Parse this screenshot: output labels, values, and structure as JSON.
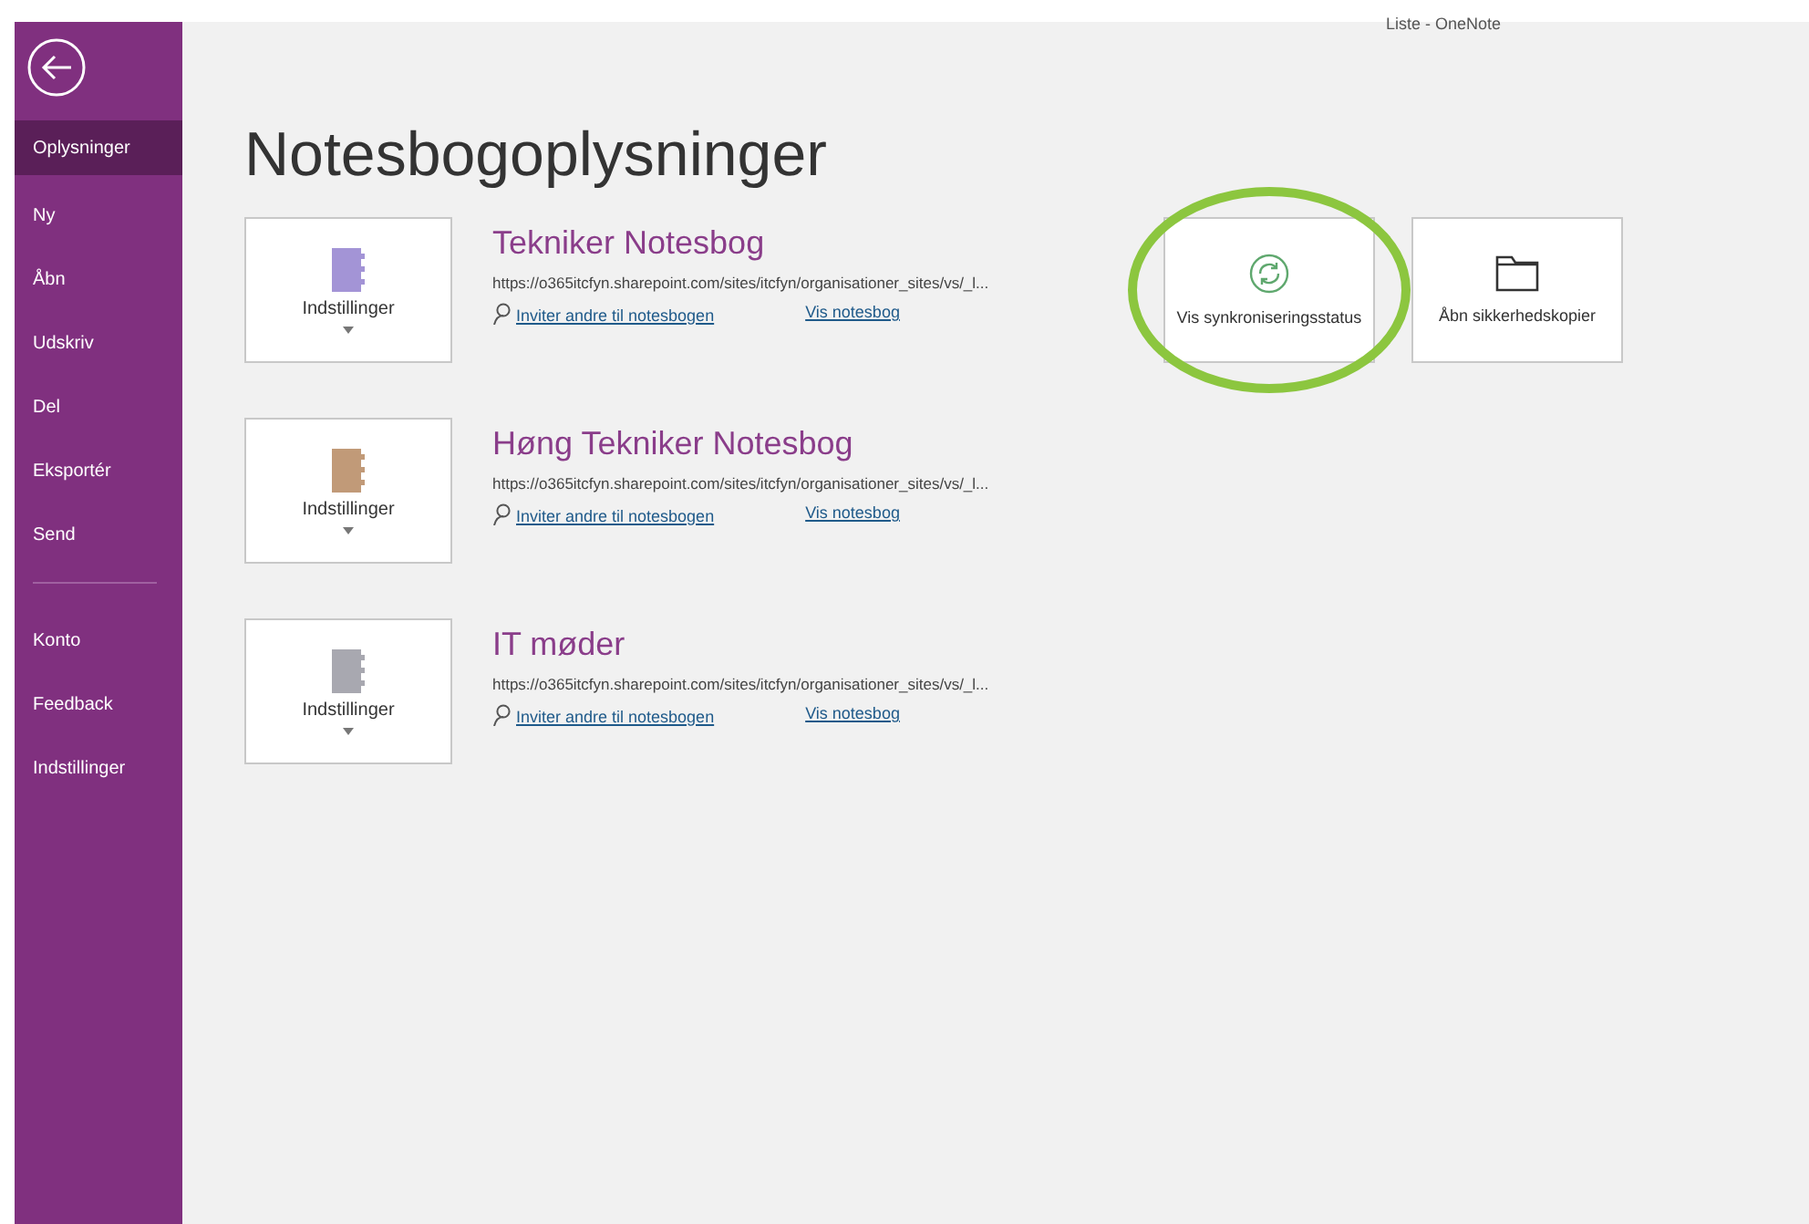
{
  "window": {
    "title": "Liste - OneNote"
  },
  "sidebar": {
    "nav_items": [
      {
        "label": "Oplysninger",
        "selected": true
      },
      {
        "label": "Ny",
        "selected": false
      },
      {
        "label": "Åbn",
        "selected": false
      },
      {
        "label": "Udskriv",
        "selected": false
      },
      {
        "label": "Del",
        "selected": false
      },
      {
        "label": "Eksportér",
        "selected": false
      },
      {
        "label": "Send",
        "selected": false
      }
    ],
    "account_items": [
      {
        "label": "Konto",
        "selected": false
      },
      {
        "label": "Feedback",
        "selected": false
      },
      {
        "label": "Indstillinger",
        "selected": false
      }
    ]
  },
  "page_title": "Notesbogoplysninger",
  "notebooks": [
    {
      "name": "Tekniker Notesbog",
      "color": "#a394d6",
      "settings": "Indstillinger",
      "url": "https://o365itcfyn.sharepoint.com/sites/itcfyn/organisationer_sites/vs/_l...",
      "invite": "Inviter andre til notesbogen",
      "view": "Vis notesbog"
    },
    {
      "name": "Høng Tekniker Notesbog",
      "color": "#c19a78",
      "settings": "Indstillinger",
      "url": "https://o365itcfyn.sharepoint.com/sites/itcfyn/organisationer_sites/vs/_l...",
      "invite": "Inviter andre til notesbogen",
      "view": "Vis notesbog"
    },
    {
      "name": "IT møder",
      "color": "#a8a8b0",
      "settings": "Indstillinger",
      "url": "https://o365itcfyn.sharepoint.com/sites/itcfyn/organisationer_sites/vs/_l...",
      "invite": "Inviter andre til notesbogen",
      "view": "Vis notesbog"
    }
  ],
  "actions": [
    {
      "kind": "sync",
      "label": "Vis synkroniseringsstatus",
      "highlighted": true
    },
    {
      "kind": "folder",
      "label": "Åbn sikkerhedskopier",
      "highlighted": false
    }
  ]
}
